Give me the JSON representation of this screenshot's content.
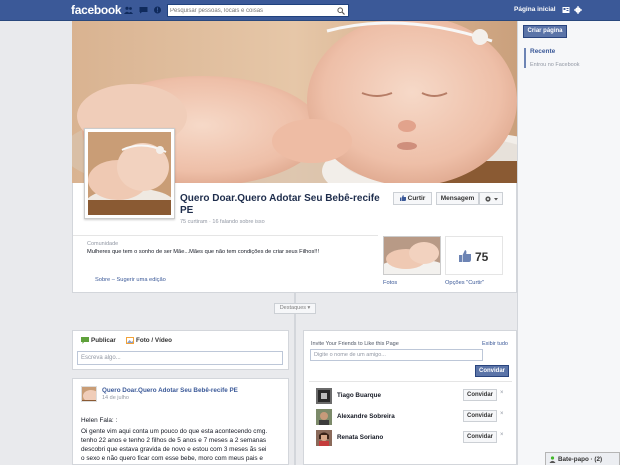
{
  "topbar": {
    "logo": "facebook",
    "search_placeholder": "Pesquisar pessoas, locais e coisas",
    "home_label": "Página inicial",
    "brand_color": "#3b5998"
  },
  "sidebar": {
    "create_page_label": "Criar página",
    "nav_recent": "Recente",
    "nav_joined": "Entrou no Facebook"
  },
  "page": {
    "name": "Quero Doar.Quero Adotar Seu Bebê-recife PE",
    "stats": "75 curtiram · 16 falando sobre isso",
    "like_label": "Curtir",
    "message_label": "Mensagem",
    "category": "Comunidade",
    "about": "Mulheres que tem o sonho de ser Mãe...Mães que não tem condições de criar seus Filhos!!!",
    "about_links": "Sobre – Sugerir uma edição",
    "photos_label": "Fotos",
    "likes_count": "75",
    "likes_label": "Opções \"Curtir\"",
    "highlights_label": "Destaques"
  },
  "composer": {
    "tab_publish": "Publicar",
    "tab_photo": "Foto / Vídeo",
    "placeholder": "Escreva algo..."
  },
  "post": {
    "author": "Quero Doar.Quero Adotar Seu Bebê-recife PE",
    "date": "14 de julho",
    "lines": [
      "Helen Fala: :",
      "Oi gente vim aqui conta um pouco do que esta acontecendo cmg.",
      "tenho 22 anos e tenho 2 filhos de 5 anos e 7 meses a 2 semanas",
      "descobri que estava gravida de novo e estou com 3 meses ãs sei",
      "o sexo e não quero ficar com esse bebe, moro com meus pais e"
    ]
  },
  "invite": {
    "title": "Invite Your Friends to Like this Page",
    "see_all": "Exibir tudo",
    "input_placeholder": "Digite o nome de um amigo...",
    "button_label": "Convidar",
    "friends": [
      {
        "name": "Tiago Buarque",
        "invite_label": "Convidar",
        "remove": "×"
      },
      {
        "name": "Alexandre Sobreira",
        "invite_label": "Convidar",
        "remove": "×"
      },
      {
        "name": "Renata Soriano",
        "invite_label": "Convidar",
        "remove": "×"
      }
    ]
  },
  "chat": {
    "label": "Bate-papo · (2)"
  }
}
